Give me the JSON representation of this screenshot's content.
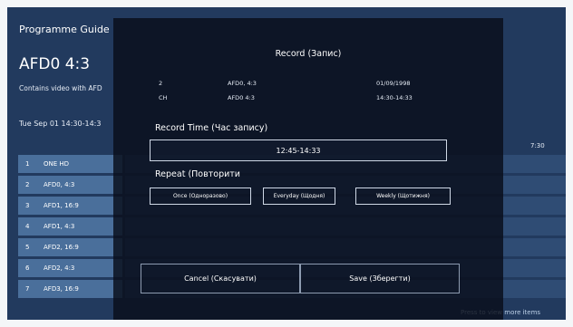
{
  "epg": {
    "title": "Programme Guide",
    "channel_name": "AFD0 4:3",
    "description": "Contains video with AFD",
    "datetime": "Tue Sep 01 14:30-14:3",
    "time_right": "7:30",
    "hint": "Press to view more items",
    "channels": [
      {
        "num": "1",
        "name": "ONE HD"
      },
      {
        "num": "2",
        "name": "AFD0, 4:3"
      },
      {
        "num": "3",
        "name": "AFD1, 16:9"
      },
      {
        "num": "4",
        "name": "AFD1, 4:3"
      },
      {
        "num": "5",
        "name": "AFD2, 16:9"
      },
      {
        "num": "6",
        "name": "AFD2, 4:3"
      },
      {
        "num": "7",
        "name": "AFD3, 16:9"
      }
    ]
  },
  "dialog": {
    "title": "Record (Запис)",
    "info_row1": {
      "number": "2",
      "channel": "AFD0, 4:3",
      "date": "01/09/1998"
    },
    "info_row2": {
      "icon": "CH",
      "channel": "AFD0 4:3",
      "time": "14:30-14:33"
    },
    "record_time_label": "Record Time (Час запису)",
    "record_time_value": "12:45-14:33",
    "repeat_label": "Repeat (Повторити",
    "repeat_options": [
      "Once (Одноразово)",
      "Everyday (Щодня)",
      "Weekly (Щотижня)"
    ],
    "cancel_label": "Cancel (Скасувати)",
    "save_label": "Save (Зберегти)"
  }
}
